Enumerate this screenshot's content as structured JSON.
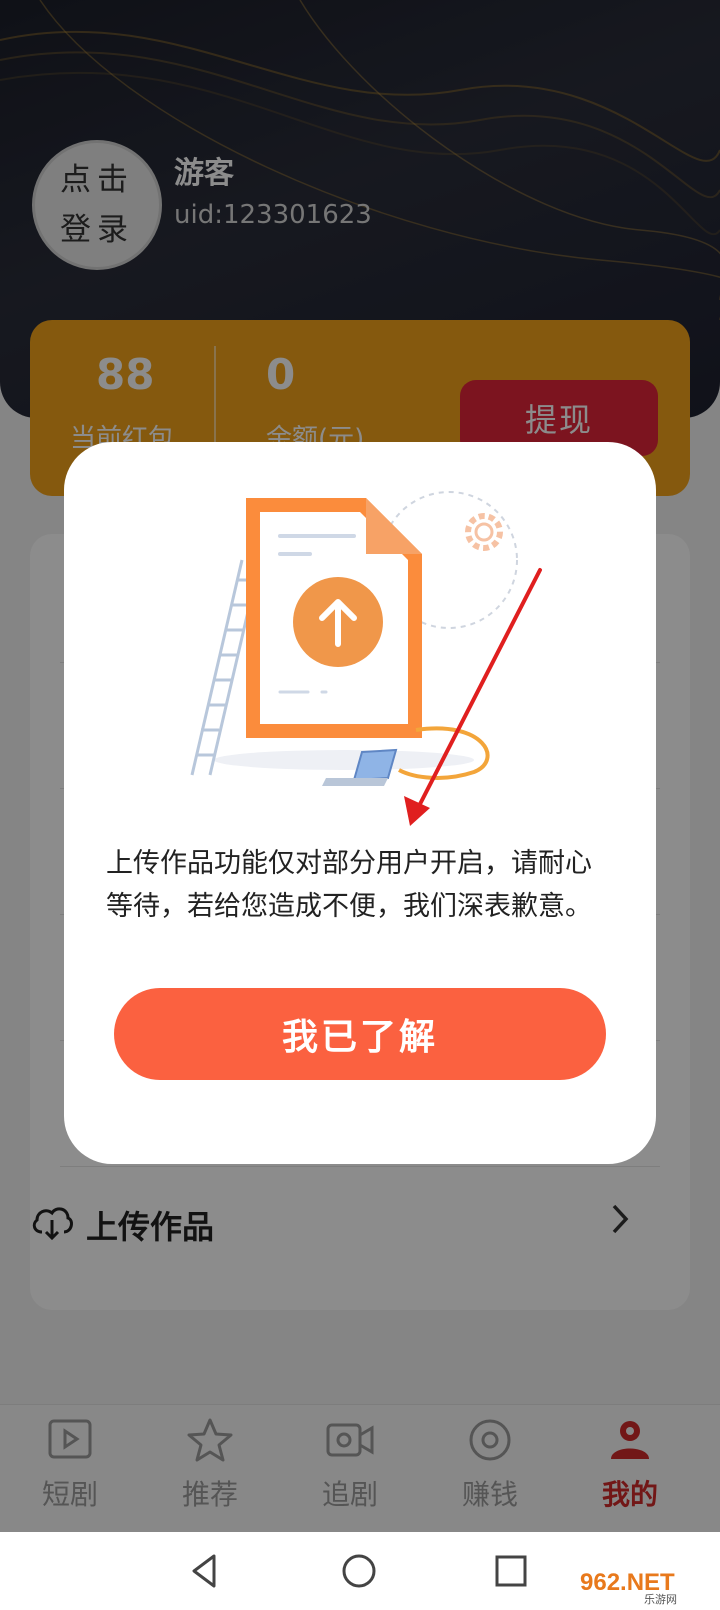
{
  "profile": {
    "avatar_line1": "点击",
    "avatar_line2": "登录",
    "username": "游客",
    "uid": "uid:123301623"
  },
  "stats": {
    "red_packet_value": "88",
    "red_packet_label": "当前红包",
    "balance_value": "0",
    "balance_label": "余额(元)",
    "withdraw_label": "提现"
  },
  "menu": {
    "upload_label": "上传作品"
  },
  "tabs": [
    {
      "label": "短剧",
      "icon": "play-video-icon"
    },
    {
      "label": "推荐",
      "icon": "star-icon"
    },
    {
      "label": "追剧",
      "icon": "video-camera-icon"
    },
    {
      "label": "赚钱",
      "icon": "coin-icon"
    },
    {
      "label": "我的",
      "icon": "profile-icon"
    }
  ],
  "dialog": {
    "message": "上传作品功能仅对部分用户开启，请耐心等待，若给您造成不便，我们深表歉意。",
    "confirm_label": "我已了解"
  },
  "watermark": {
    "brand": "962.NET",
    "sub": "乐游网"
  },
  "colors": {
    "accent_orange": "#f2a21a",
    "withdraw_red": "#e2263a",
    "button_orange": "#fb6140",
    "active_tab": "#cf2a2a"
  }
}
